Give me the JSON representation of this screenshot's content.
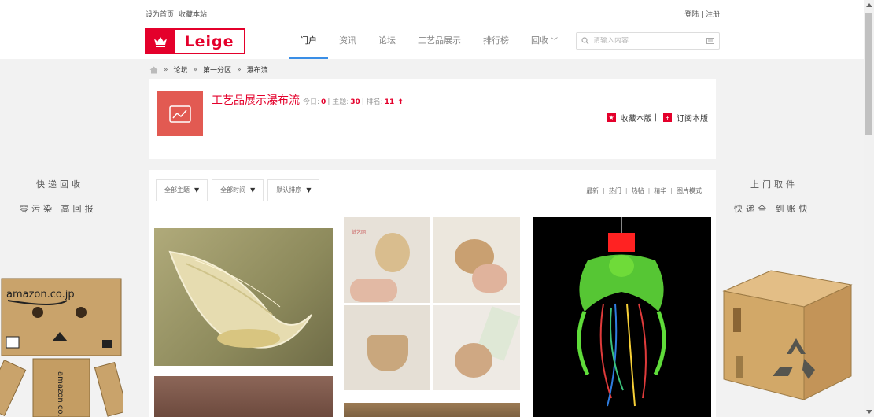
{
  "topbar": {
    "set_home": "设为首页",
    "bookmark": "收藏本站"
  },
  "auth": {
    "text": "登陆 | 注册"
  },
  "logo": {
    "text": "Leige"
  },
  "nav": {
    "items": [
      {
        "label": "门户"
      },
      {
        "label": "资讯"
      },
      {
        "label": "论坛"
      },
      {
        "label": "工艺品展示"
      },
      {
        "label": "排行榜"
      },
      {
        "label": "回收"
      }
    ],
    "active_index": 0
  },
  "search": {
    "placeholder": "请输入内容"
  },
  "breadcrumb": {
    "sep": "»",
    "items": [
      "论坛",
      "第一分区",
      "瀑布流"
    ]
  },
  "forum": {
    "name": "工艺品展示瀑布流",
    "today_label": "今日:",
    "today": "0",
    "topics_label": "| 主题:",
    "topics": "30",
    "rank_label": "| 排名:",
    "rank": "11",
    "rank_arrow": "⬆",
    "favorite": "收藏本版",
    "favorite_sep": "|",
    "subscribe": "订阅本版"
  },
  "left_ad": {
    "line1": "快递回收",
    "line2": "零污染  高回报",
    "box_label": "amazon.co.jp"
  },
  "right_ad": {
    "line1": "上门取件",
    "line2": "快递全  到账快"
  },
  "filters": [
    {
      "label": "全部主题"
    },
    {
      "label": "全部时间"
    },
    {
      "label": "默认排序"
    }
  ],
  "sorts": [
    "最新",
    "热门",
    "热帖",
    "精华",
    "图片模式"
  ],
  "sort_sep": "|",
  "tiles": {
    "craft_watermark": "纸艺网"
  },
  "colors": {
    "brand": "#e4002b",
    "accent": "#3a8ee6",
    "icon_bg": "#e25a52"
  }
}
